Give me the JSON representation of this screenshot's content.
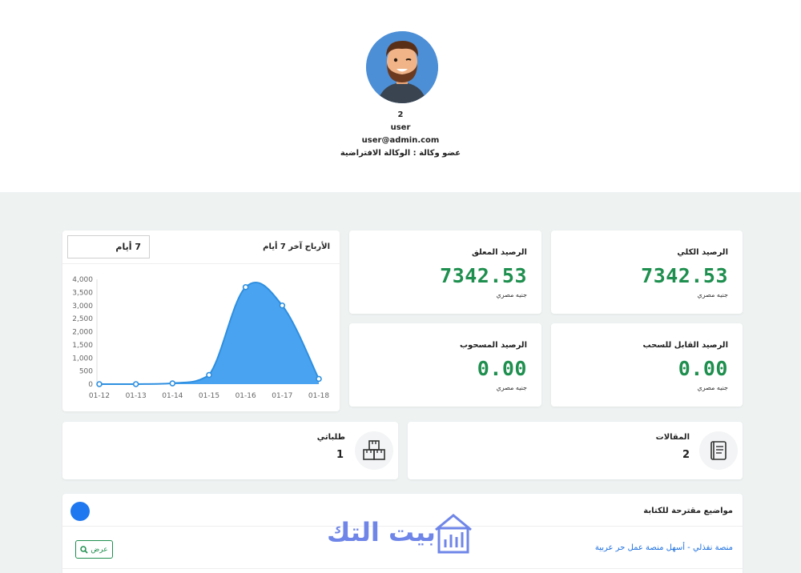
{
  "profile": {
    "id": "2",
    "username": "user",
    "email": "user@admin.com",
    "agency": "عضو وكالة : الوكالة الافتراضية"
  },
  "balances": {
    "total": {
      "label": "الرصيد الكلي",
      "value": "7342.53",
      "unit": "جنيه مصري"
    },
    "pending": {
      "label": "الرصيد المعلق",
      "value": "7342.53",
      "unit": "جنيه مصري"
    },
    "withdrawable": {
      "label": "الرصيد القابل للسحب",
      "value": "0.00",
      "unit": "جنيه مصري"
    },
    "withdrawn": {
      "label": "الرصيد المسحوب",
      "value": "0.00",
      "unit": "جنيه مصري"
    }
  },
  "earnings_chart": {
    "title": "الأرباح آخر 7 أيام",
    "period": "7 أيام"
  },
  "chart_data": {
    "type": "area",
    "title": "الأرباح آخر 7 أيام",
    "categories": [
      "01-12",
      "01-13",
      "01-14",
      "01-15",
      "01-16",
      "01-17",
      "01-18"
    ],
    "values": [
      0,
      0,
      30,
      350,
      3700,
      3000,
      200
    ],
    "yticks": [
      "4,000",
      "3,500",
      "3,000",
      "2,500",
      "2,000",
      "1,500",
      "1,000",
      "500",
      "0"
    ],
    "ylim": [
      0,
      4000
    ],
    "color": "#4aa3f0",
    "line_color": "#2e8fe0",
    "grid": false
  },
  "counts": {
    "articles": {
      "label": "المقالات",
      "value": "2",
      "icon": "book-icon"
    },
    "orders": {
      "label": "طلباتي",
      "value": "1",
      "icon": "boxes-icon"
    }
  },
  "topics": {
    "title": "مواضيع مقترحة للكتابة",
    "item_link": "منصة نفذلي - أسهل منصة عمل حر عربية",
    "view_label": "عرض"
  },
  "watermark": {
    "text": "بيت التك"
  },
  "colors": {
    "accent_green": "#1e8f4e",
    "link_blue": "#1b6fe0",
    "dot_blue": "#1f78f0",
    "background": "#eef3f2"
  }
}
